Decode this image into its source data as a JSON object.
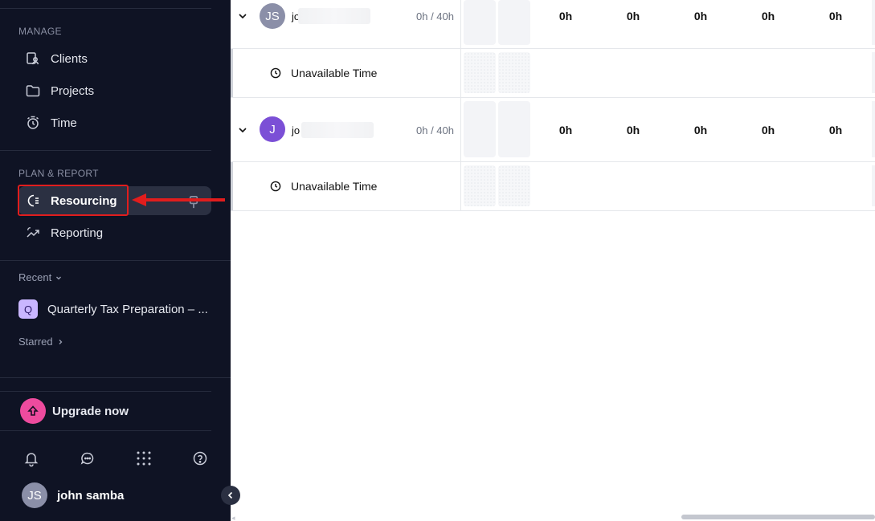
{
  "sidebar": {
    "manage_label": "MANAGE",
    "manage_items": [
      {
        "label": "Clients",
        "icon": "clients-icon"
      },
      {
        "label": "Projects",
        "icon": "folder-icon"
      },
      {
        "label": "Time",
        "icon": "stopwatch-icon"
      }
    ],
    "plan_label": "PLAN & REPORT",
    "plan_items": [
      {
        "label": "Resourcing",
        "icon": "resourcing-icon",
        "active": true
      },
      {
        "label": "Reporting",
        "icon": "reporting-icon"
      }
    ],
    "recent_label": "Recent",
    "recent_items": [
      {
        "badge": "Q",
        "label": "Quarterly Tax Preparation – ..."
      }
    ],
    "starred_label": "Starred",
    "upgrade_label": "Upgrade now",
    "user": {
      "initials": "JS",
      "name": "john samba"
    }
  },
  "grid": {
    "people": [
      {
        "initials": "JS",
        "name_visible": "jo",
        "avatar_color": "#8b8fa8",
        "capacity": "0h / 40h",
        "hours": [
          "0h",
          "0h",
          "0h",
          "0h",
          "0h"
        ],
        "sub_label": "Unavailable Time"
      },
      {
        "initials": "J",
        "name_visible": "jo",
        "avatar_color": "#7b4fd6",
        "capacity": "0h / 40h",
        "hours": [
          "0h",
          "0h",
          "0h",
          "0h",
          "0h"
        ],
        "sub_label": "Unavailable Time"
      }
    ]
  },
  "colors": {
    "sidebar_bg": "#0f1324",
    "active_item_bg": "#2b3042",
    "highlight": "#e11d1d",
    "upgrade_accent": "#ee4b9e"
  }
}
